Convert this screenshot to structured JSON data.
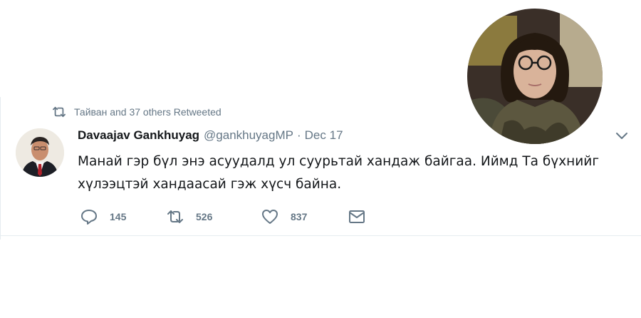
{
  "retweet_context": {
    "icon": "retweet-icon",
    "text": "Тайван and 37 others Retweeted"
  },
  "tweet": {
    "author_name": "Davaajav Gankhuyag",
    "handle": "@gankhuyagMP",
    "separator": "·",
    "date": "Dec 17",
    "text_line1": "Манай гэр бүл энэ асуудалд ул суурьтай хандаж байгаа. Иймд Та бүхнийг",
    "text_line2": "хүлээцтэй хандаасай гэж хүсч байна.",
    "caret_icon": "chevron-down-icon"
  },
  "actions": {
    "reply": {
      "icon": "reply-icon",
      "count": "145"
    },
    "retweet": {
      "icon": "retweet-icon",
      "count": "526"
    },
    "like": {
      "icon": "heart-icon",
      "count": "837"
    },
    "message": {
      "icon": "envelope-icon"
    }
  },
  "colors": {
    "text_primary": "#14171a",
    "text_secondary": "#657786",
    "divider": "#e6ecf0"
  }
}
